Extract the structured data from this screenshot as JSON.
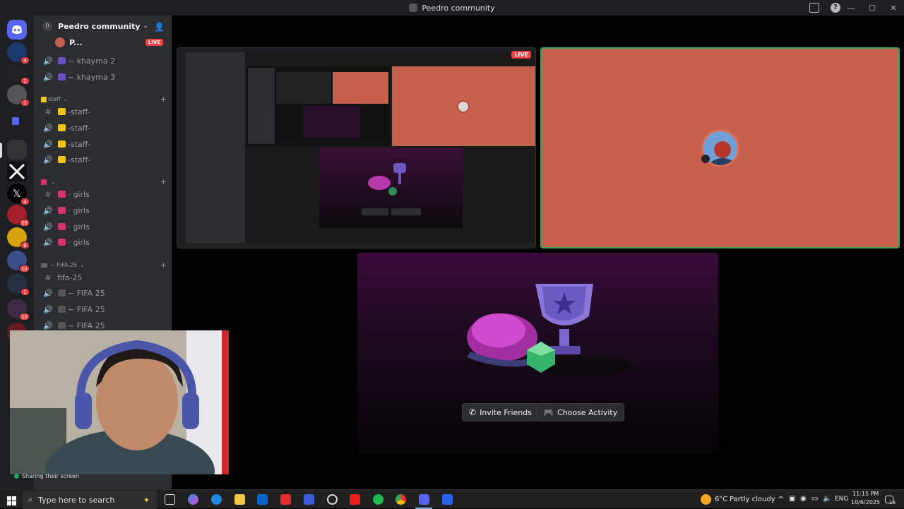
{
  "window": {
    "title": "Peedro community"
  },
  "server": {
    "name": "Peedro community",
    "boost_count": "0",
    "live_label": "LIVE",
    "stream_user": "P..."
  },
  "voice_rows": [
    {
      "name": "~ khayma 2"
    },
    {
      "name": "~ khayma 3"
    }
  ],
  "categories": [
    {
      "name": "staff",
      "channels": [
        "-staff-",
        "-staff-",
        "-staff-",
        "-staff-"
      ]
    },
    {
      "name": "",
      "channels": [
        "girls",
        "girls",
        "girls",
        "girls"
      ]
    },
    {
      "name": "~ FIFA 25",
      "channels": [
        "fifa-25",
        "~ FIFA 25",
        "~ FIFA 25",
        "~ FIFA 25"
      ]
    }
  ],
  "server_badges": [
    "4",
    "1",
    "1",
    "4",
    "28",
    "6",
    "14",
    "1",
    "16"
  ],
  "activity": {
    "invite_label": "Invite Friends",
    "choose_label": "Choose Activity"
  },
  "webcam": {
    "status_text": "Sharing their screen"
  },
  "taskbar": {
    "search_placeholder": "Type here to search",
    "weather_temp": "6°C",
    "weather_text": "Partly cloudy",
    "language": "ENG",
    "time": "11:15 PM",
    "date": "10/6/2025",
    "notification_count": "18"
  },
  "colors": {
    "stream_bg": "#c4604b",
    "accent_live": "#f23f43",
    "sidebar_bg": "#2b2d31",
    "rail_bg": "#1e1f22"
  }
}
